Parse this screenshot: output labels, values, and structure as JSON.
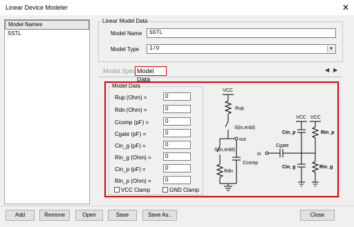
{
  "window": {
    "title": "Linear Device Modeler",
    "close_glyph": "✕"
  },
  "names_panel": {
    "header": "Model Names",
    "items": [
      "SSTL"
    ]
  },
  "linear_model": {
    "legend": "Linear Model Data",
    "name_label": "Model Name",
    "name_value": "SSTL",
    "type_label": "Model Type",
    "type_value": "I/O"
  },
  "tabs": {
    "spec": "Model Spec",
    "data": "Model Data",
    "prev": "◀",
    "next": "▶"
  },
  "model_data": {
    "legend": "Model Data",
    "fields": [
      {
        "label": "Rup (Ohm) =",
        "value": "0"
      },
      {
        "label": "Rdn (Ohm) =",
        "value": "0"
      },
      {
        "label": "Ccomp (pF) =",
        "value": "0"
      },
      {
        "label": "Cgate (pF) =",
        "value": "0"
      },
      {
        "label": "Cin_g (pF) =",
        "value": "0"
      },
      {
        "label": "Rin_g (Ohm) =",
        "value": "0"
      },
      {
        "label": "Cin_p (pF) =",
        "value": "0"
      },
      {
        "label": "Rin_p (Ohm) =",
        "value": "0"
      }
    ],
    "vcc_clamp": "VCC Clamp",
    "gnd_clamp": "GND Clamp"
  },
  "schematic": {
    "vcc_left": "VCC",
    "rup": "Rup",
    "s_top": "S(in,enbl)",
    "out": "out",
    "s_bot": "S(in,enbl)",
    "ccomp": "Ccomp",
    "rdn": "Rdn",
    "vcc_r1": "VCC",
    "vcc_r2": "VCC",
    "cin_p": "Cin_p",
    "rin_p": "Rin_p",
    "in": "in",
    "cgate": "Cgate",
    "cin_g": "Cin_g",
    "rin_g": "Rin_g"
  },
  "buttons": {
    "add": "Add",
    "remove": "Remove",
    "open": "Open",
    "save": "Save",
    "save_as": "Save As..",
    "close": "Close"
  }
}
